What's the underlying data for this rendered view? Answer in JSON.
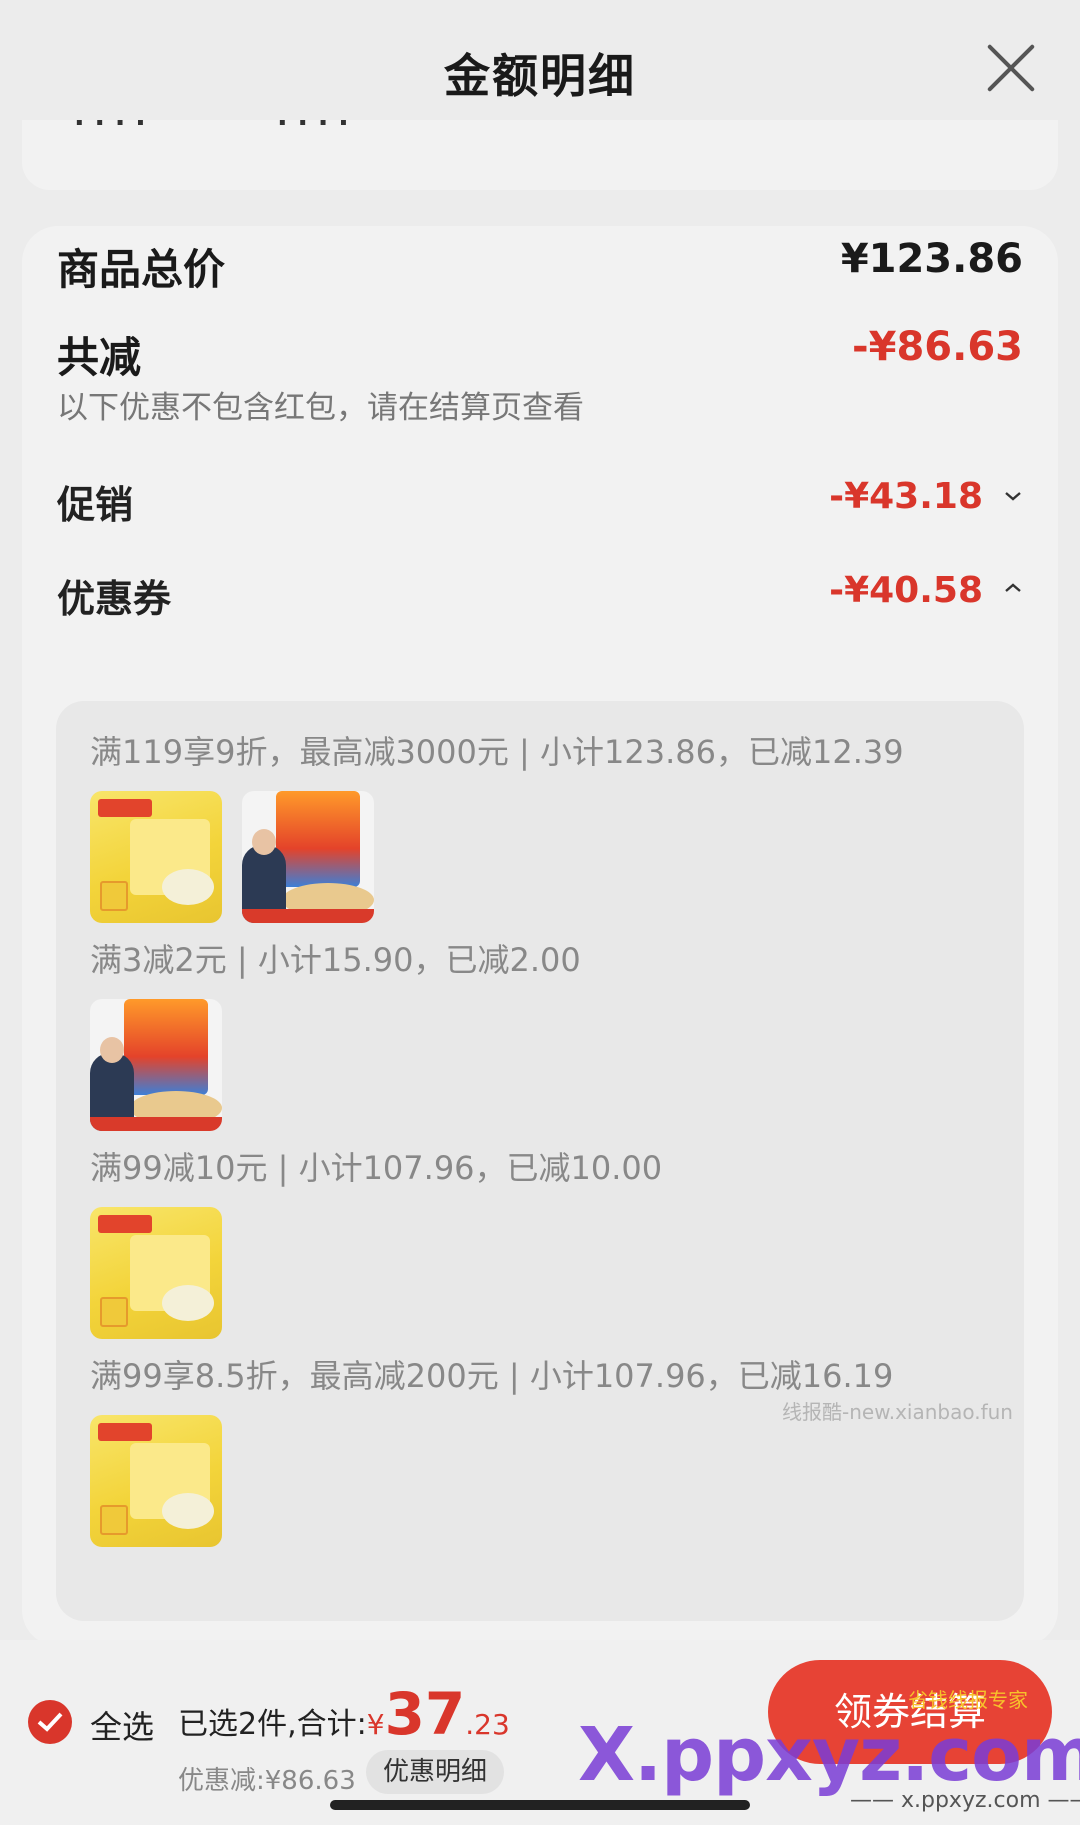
{
  "header": {
    "title": "金额明细"
  },
  "summary": {
    "total_label": "商品总价",
    "total_value": "¥123.86",
    "discount_label": "共减",
    "discount_value": "-¥86.63",
    "note": "以下优惠不包含红包，请在结算页查看",
    "promo_label": "促销",
    "promo_value": "-¥43.18",
    "coupon_label": "优惠券",
    "coupon_value": "-¥40.58"
  },
  "coupons": [
    {
      "text": "满119享9折，最高减3000元 | 小计123.86，已减12.39"
    },
    {
      "text": "满3减2元 | 小计15.90，已减2.00"
    },
    {
      "text": "满99减10元 | 小计107.96，已减10.00"
    },
    {
      "text": "满99享8.5折，最高减200元 | 小计107.96，已减16.19"
    }
  ],
  "watermark_small": "线报酷-new.xianbao.fun",
  "bottom": {
    "select_all": "全选",
    "selected_text": "已选2件,合计:",
    "currency": "¥",
    "amount_int": "37",
    "amount_dec": ".23",
    "saved_text": "优惠减:¥86.63",
    "detail_button": "优惠明细",
    "checkout_button": "领券结算",
    "brand_watermark": "X.ppxyz.com",
    "brand_sub": "—— x.ppxyz.com ——",
    "brand_tag": "省钱线报专家"
  },
  "colors": {
    "accent": "#d9362b",
    "button": "#e74335"
  }
}
